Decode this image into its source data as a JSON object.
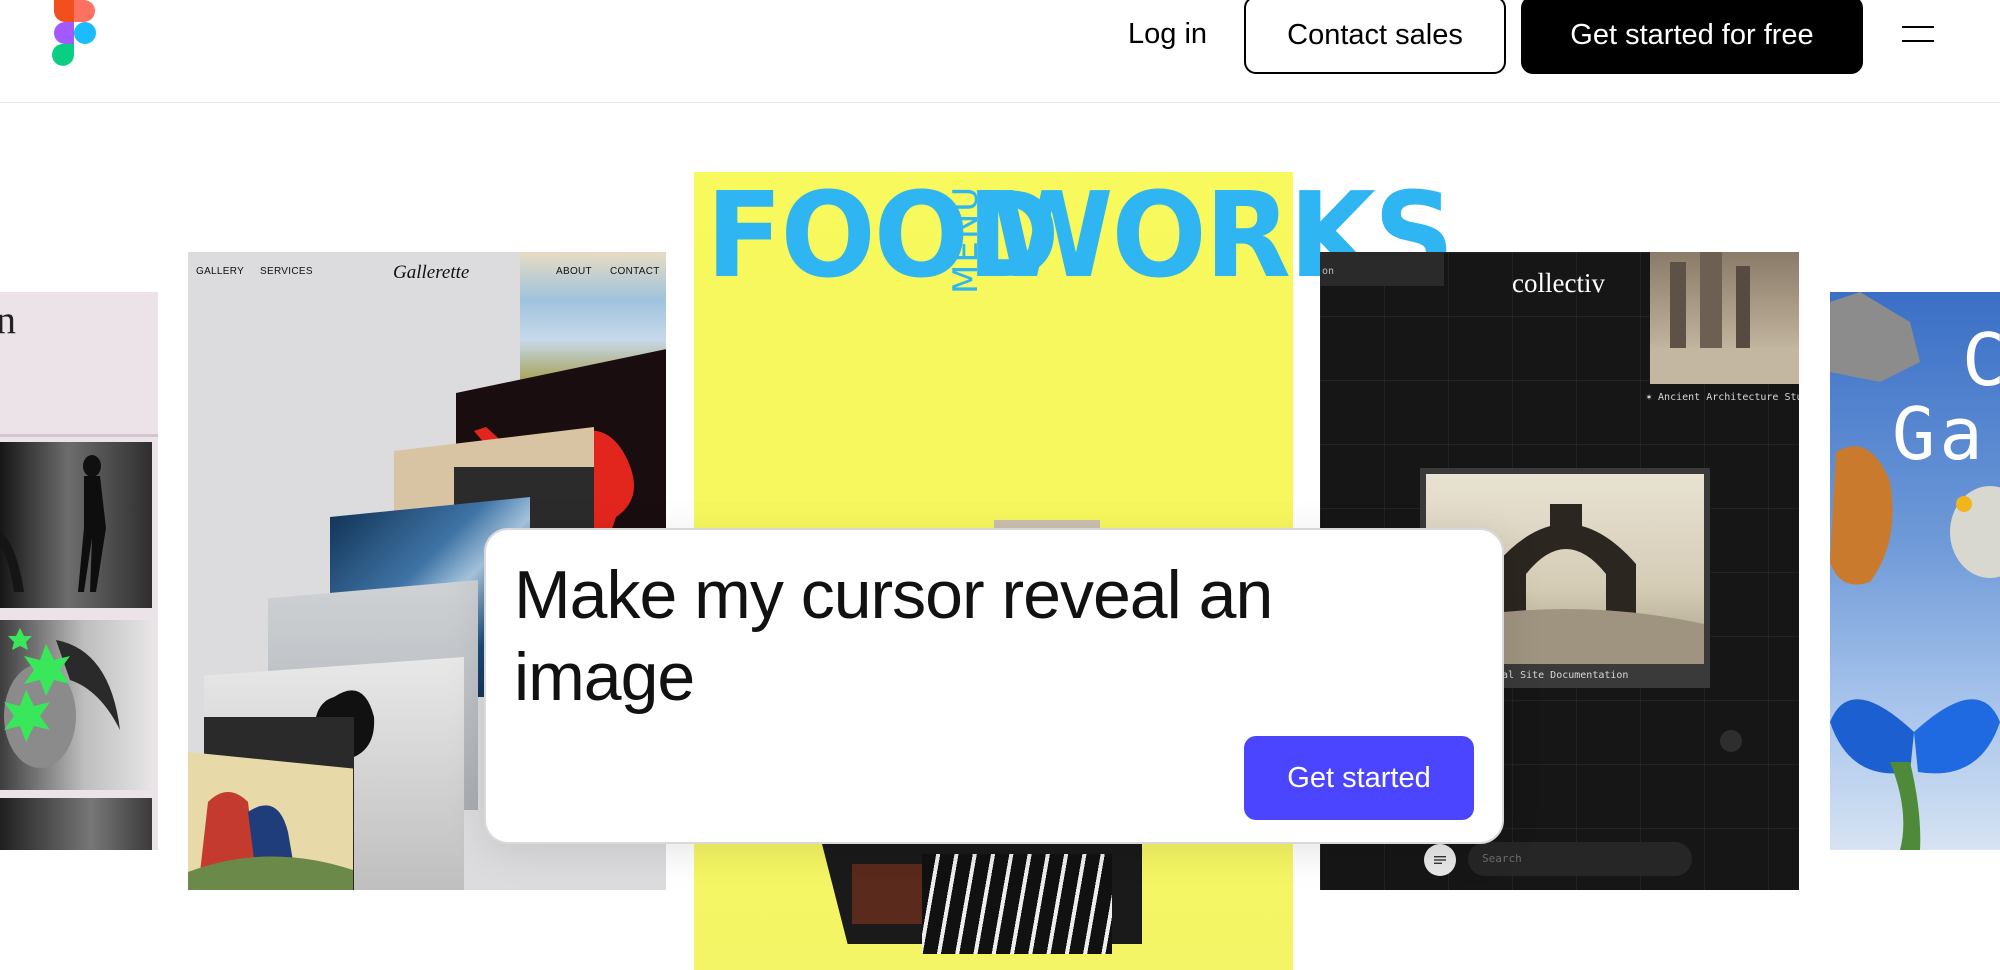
{
  "header": {
    "logo_icon": "figma-logo",
    "login_label": "Log in",
    "contact_sales_label": "Contact sales",
    "get_started_label": "Get started for free",
    "menu_icon": "hamburger-menu-icon"
  },
  "gallery": {
    "card_pink": {
      "heading_fragment": "n"
    },
    "card_gallerette": {
      "nav_gallery": "GALLERY",
      "nav_services": "SERVICES",
      "title": "Gallerette",
      "nav_about": "ABOUT",
      "nav_contact": "CONTACT"
    },
    "card_food": {
      "title_left": "FOOD",
      "title_middle": "MENU",
      "title_right": "WORKS"
    },
    "card_collectiv": {
      "title": "collectiv",
      "tab_fragment": "on",
      "caption_top": "✶ Ancient Architecture Stu",
      "caption_bottom": "cal Site Documentation",
      "search_placeholder": "Search"
    },
    "card_butterfly": {
      "letters": [
        "C",
        "Ga"
      ]
    }
  },
  "prompt": {
    "text": "Make my cursor reveal an image",
    "button_label": "Get started"
  },
  "colors": {
    "accent_button": "#4c45ff",
    "food_yellow": "#f6f85c",
    "food_blue": "#2fb6f2"
  }
}
